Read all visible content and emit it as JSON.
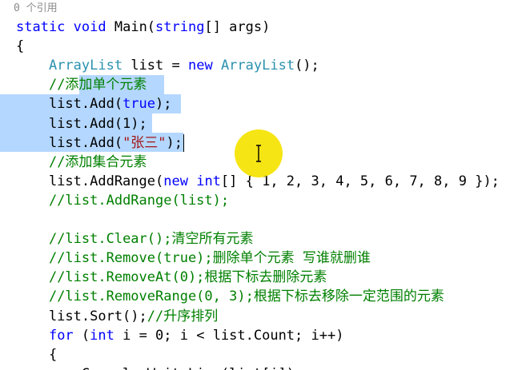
{
  "codelens": "0 个引用",
  "lines": [
    [
      {
        "t": "static",
        "c": "kw"
      },
      {
        "t": " ",
        "c": "pl"
      },
      {
        "t": "void",
        "c": "kw"
      },
      {
        "t": " Main(",
        "c": "pl"
      },
      {
        "t": "string",
        "c": "kw"
      },
      {
        "t": "[] args)",
        "c": "pl"
      }
    ],
    [
      {
        "t": "{",
        "c": "pl"
      }
    ],
    [
      {
        "t": "    ",
        "c": "pl"
      },
      {
        "t": "ArrayList",
        "c": "ty"
      },
      {
        "t": " list = ",
        "c": "pl"
      },
      {
        "t": "new",
        "c": "kw"
      },
      {
        "t": " ",
        "c": "pl"
      },
      {
        "t": "ArrayList",
        "c": "ty"
      },
      {
        "t": "();",
        "c": "pl"
      }
    ],
    [
      {
        "t": "    ",
        "c": "pl"
      },
      {
        "t": "//添加单个元素",
        "c": "cm"
      }
    ],
    [
      {
        "t": "    list.Add(",
        "c": "pl"
      },
      {
        "t": "true",
        "c": "kw"
      },
      {
        "t": ");",
        "c": "pl"
      }
    ],
    [
      {
        "t": "    list.Add(1);",
        "c": "pl"
      }
    ],
    [
      {
        "t": "    list.Add(",
        "c": "pl"
      },
      {
        "t": "\"张三\"",
        "c": "st"
      },
      {
        "t": ");",
        "c": "pl"
      }
    ],
    [
      {
        "t": "    ",
        "c": "pl"
      },
      {
        "t": "//添加集合元素",
        "c": "cm"
      }
    ],
    [
      {
        "t": "    list.AddRange(",
        "c": "pl"
      },
      {
        "t": "new",
        "c": "kw"
      },
      {
        "t": " ",
        "c": "pl"
      },
      {
        "t": "int",
        "c": "kw"
      },
      {
        "t": "[] { 1, 2, 3, 4, 5, 6, 7, 8, 9 });",
        "c": "pl"
      }
    ],
    [
      {
        "t": "    ",
        "c": "pl"
      },
      {
        "t": "//list.AddRange(list);",
        "c": "cm"
      }
    ],
    [
      {
        "t": "",
        "c": "pl"
      }
    ],
    [
      {
        "t": "    ",
        "c": "pl"
      },
      {
        "t": "//list.Clear();清空所有元素",
        "c": "cm"
      }
    ],
    [
      {
        "t": "    ",
        "c": "pl"
      },
      {
        "t": "//list.Remove(true);删除单个元素 写谁就删谁",
        "c": "cm"
      }
    ],
    [
      {
        "t": "    ",
        "c": "pl"
      },
      {
        "t": "//list.RemoveAt(0);根据下标去删除元素",
        "c": "cm"
      }
    ],
    [
      {
        "t": "    ",
        "c": "pl"
      },
      {
        "t": "//list.RemoveRange(0, 3);根据下标去移除一定范围的元素",
        "c": "cm"
      }
    ],
    [
      {
        "t": "    list.Sort();",
        "c": "pl"
      },
      {
        "t": "//升序排列",
        "c": "cm"
      }
    ],
    [
      {
        "t": "    ",
        "c": "pl"
      },
      {
        "t": "for",
        "c": "kw"
      },
      {
        "t": " (",
        "c": "pl"
      },
      {
        "t": "int",
        "c": "kw"
      },
      {
        "t": " i = 0; i < list.Count; i++)",
        "c": "pl"
      }
    ],
    [
      {
        "t": "    {",
        "c": "pl"
      }
    ],
    [
      {
        "t": "        Console.WriteLine(list[i]);",
        "c": "pl"
      }
    ]
  ],
  "colors": {
    "keyword": "#0000ff",
    "type": "#2b91af",
    "comment": "#008000",
    "string": "#a31515",
    "selection": "#b4d7ff",
    "cursor_highlight": "#f5e300"
  },
  "icons": {
    "mouse_cursor": "ibeam-cursor-icon"
  }
}
